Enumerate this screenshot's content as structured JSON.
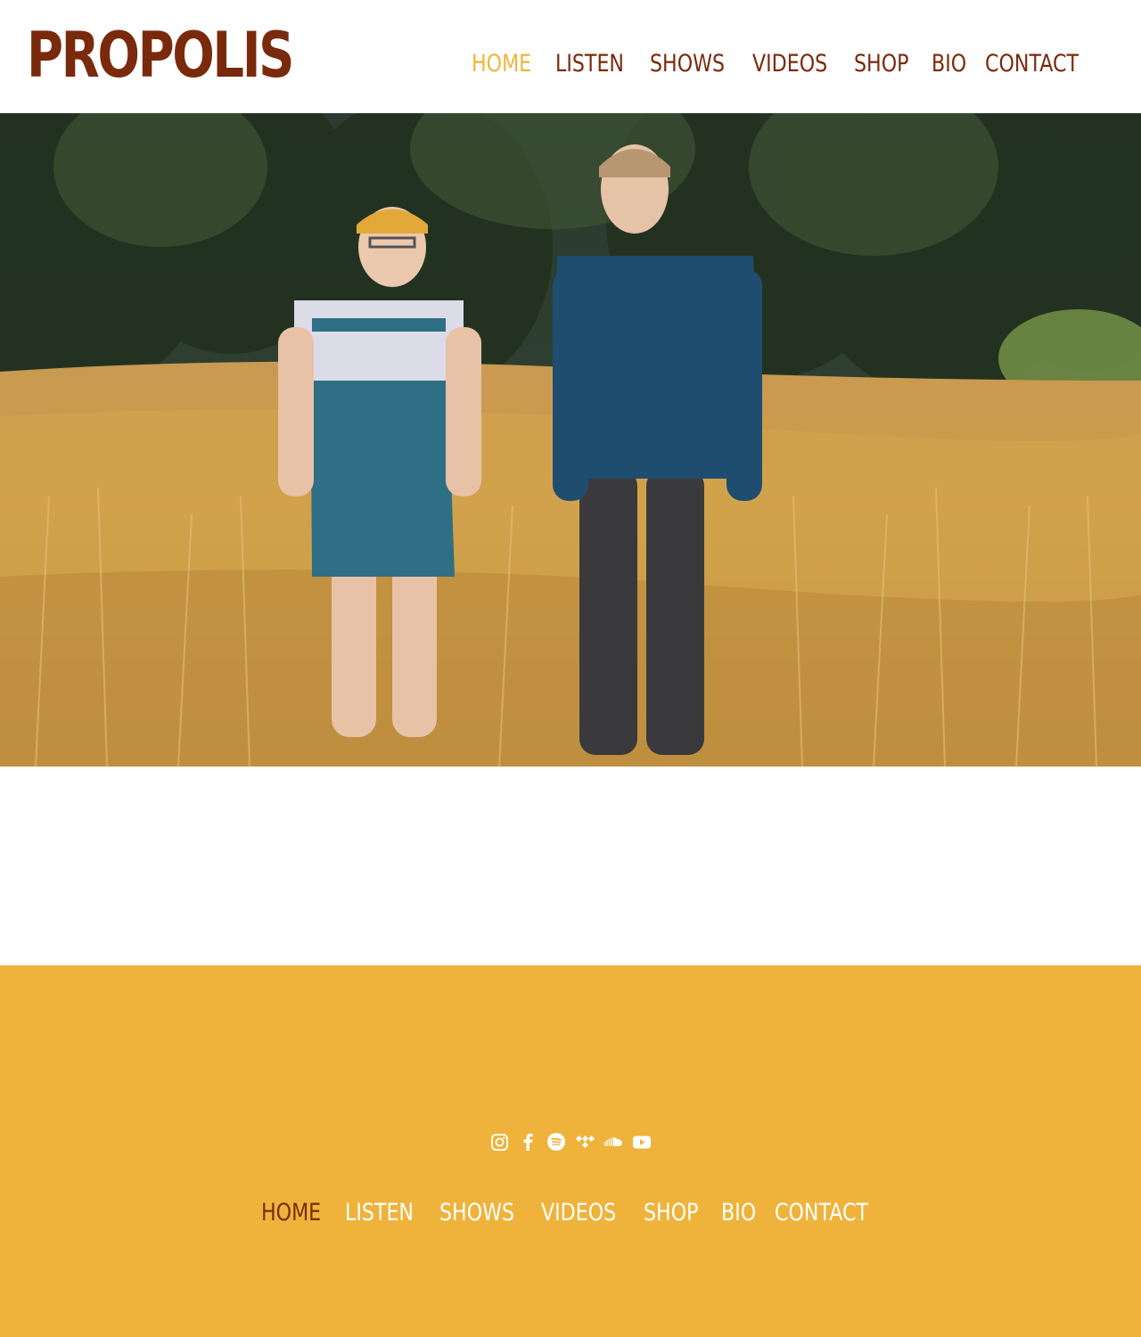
{
  "brand": {
    "name": "PROPOLIS"
  },
  "nav": {
    "items": [
      {
        "label": "HOME",
        "active": true
      },
      {
        "label": "LISTEN",
        "active": false
      },
      {
        "label": "SHOWS",
        "active": false
      },
      {
        "label": "VIDEOS",
        "active": false
      },
      {
        "label": "SHOP",
        "active": false
      },
      {
        "label": "BIO",
        "active": false
      },
      {
        "label": "CONTACT",
        "active": false
      }
    ]
  },
  "hero": {
    "image": "band-photo-two-people-in-grass-field"
  },
  "footer": {
    "social_icons": [
      "instagram-icon",
      "facebook-icon",
      "spotify-icon",
      "tidal-icon",
      "soundcloud-icon",
      "youtube-icon"
    ]
  },
  "colors": {
    "brand": "#7a2a0c",
    "accent": "#f0b43a",
    "footer_bg": "#efb33b",
    "footer_text": "#ffffff"
  }
}
